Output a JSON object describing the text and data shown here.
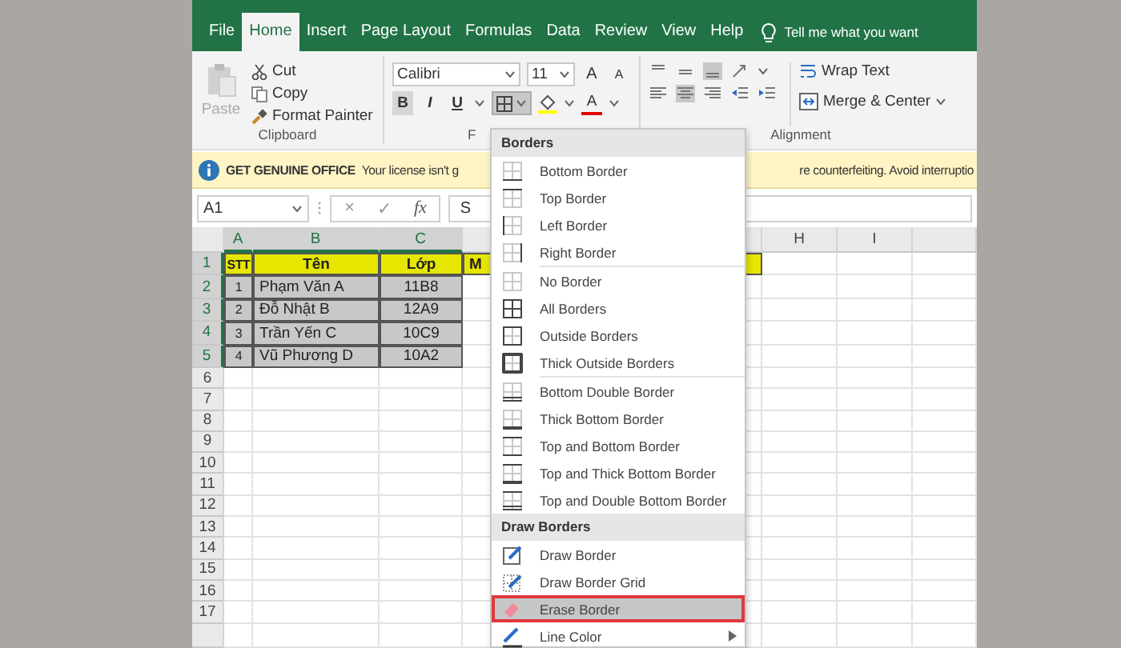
{
  "tabs": [
    {
      "label": "File",
      "selected": false
    },
    {
      "label": "Home",
      "selected": true
    },
    {
      "label": "Insert",
      "selected": false
    },
    {
      "label": "Page Layout",
      "selected": false
    },
    {
      "label": "Formulas",
      "selected": false
    },
    {
      "label": "Data",
      "selected": false
    },
    {
      "label": "Review",
      "selected": false
    },
    {
      "label": "View",
      "selected": false
    },
    {
      "label": "Help",
      "selected": false
    }
  ],
  "tell_me": "Tell me what you want",
  "ribbon": {
    "clipboard": {
      "paste": "Paste",
      "cut": "Cut",
      "copy": "Copy",
      "format_painter": "Format Painter",
      "label": "Clipboard"
    },
    "font": {
      "name": "Calibri",
      "size": "11",
      "grow": "A",
      "shrink": "A",
      "bold": "B",
      "italic": "I",
      "underline": "U",
      "font_color": "A",
      "label": "F",
      "borders_pressed": true
    },
    "alignment": {
      "wrap_text": "Wrap Text",
      "merge": "Merge & Center",
      "label": "Alignment"
    }
  },
  "message_bar": {
    "title": "GET GENUINE OFFICE",
    "text_left": "Your license isn't g",
    "text_right": "re counterfeiting. Avoid interruptio"
  },
  "formula_bar": {
    "name_box": "A1",
    "cancel": "×",
    "enter": "✓",
    "fx": "fx",
    "formula": "S"
  },
  "sheet": {
    "columns": [
      "A",
      "B",
      "C",
      "H",
      "I"
    ],
    "rows": [
      {
        "number": "1",
        "kind": "header",
        "cells": [
          "STT",
          "Tên",
          "Lớp",
          "M"
        ]
      },
      {
        "number": "2",
        "kind": "data",
        "cells": [
          "1",
          "Phạm Văn A",
          "11B8"
        ]
      },
      {
        "number": "3",
        "kind": "data",
        "cells": [
          "2",
          "Đỗ Nhật B",
          "12A9"
        ]
      },
      {
        "number": "4",
        "kind": "data",
        "cells": [
          "3",
          "Trần Yến C",
          "10C9"
        ]
      },
      {
        "number": "5",
        "kind": "data",
        "cells": [
          "4",
          "Vũ Phương D",
          "10A2"
        ]
      }
    ],
    "empty_rows": [
      "6",
      "7",
      "8",
      "9",
      "10",
      "11",
      "12",
      "13",
      "14",
      "15",
      "16",
      "17"
    ]
  },
  "menu": {
    "sections": [
      {
        "title": "Borders",
        "groups": [
          [
            {
              "label": "Bottom Border",
              "kind": "bottom",
              "selected": false
            },
            {
              "label": "Top Border",
              "kind": "top",
              "selected": false
            },
            {
              "label": "Left Border",
              "kind": "left",
              "selected": false
            },
            {
              "label": "Right Border",
              "kind": "right",
              "selected": false
            }
          ],
          [
            {
              "label": "No Border",
              "kind": "none",
              "selected": false
            },
            {
              "label": "All Borders",
              "kind": "all",
              "selected": false
            },
            {
              "label": "Outside Borders",
              "kind": "outside",
              "selected": false
            },
            {
              "label": "Thick Outside Borders",
              "kind": "thick-outside",
              "selected": false
            }
          ],
          [
            {
              "label": "Bottom Double Border",
              "kind": "bottom-double",
              "selected": false
            },
            {
              "label": "Thick Bottom Border",
              "kind": "thick-bottom",
              "selected": false
            },
            {
              "label": "Top and Bottom Border",
              "kind": "top-bottom",
              "selected": false
            },
            {
              "label": "Top and Thick Bottom Border",
              "kind": "top-thick-bottom",
              "selected": false
            },
            {
              "label": "Top and Double Bottom Border",
              "kind": "top-double-bottom",
              "selected": false
            }
          ]
        ]
      },
      {
        "title": "Draw Borders",
        "groups": [
          [
            {
              "label": "Draw Border",
              "kind": "draw",
              "selected": false,
              "submenu": false
            },
            {
              "label": "Draw Border Grid",
              "kind": "draw-grid",
              "selected": false,
              "submenu": false
            },
            {
              "label": "Erase Border",
              "kind": "erase",
              "selected": true,
              "submenu": false
            },
            {
              "label": "Line Color",
              "kind": "line-color",
              "selected": false,
              "submenu": true
            }
          ]
        ]
      }
    ]
  }
}
